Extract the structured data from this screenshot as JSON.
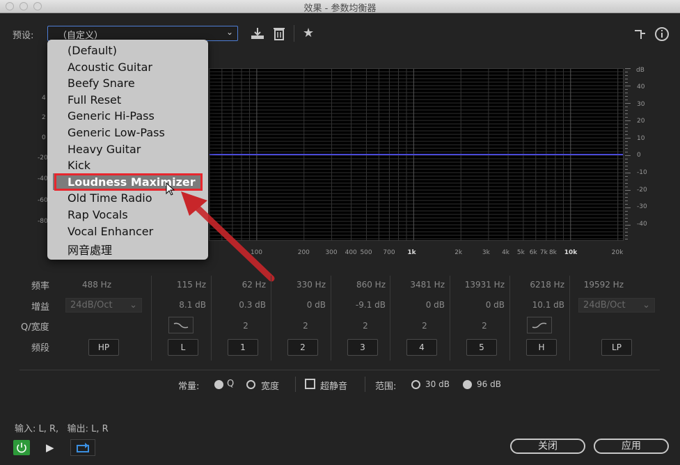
{
  "window": {
    "title": "效果 - 参数均衡器"
  },
  "preset": {
    "label": "预设:",
    "current": "（自定义）",
    "options": [
      "(Default)",
      "Acoustic Guitar",
      "Beefy Snare",
      "Full Reset",
      "Generic Hi-Pass",
      "Generic Low-Pass",
      "Heavy Guitar",
      "Kick",
      "Loudness Maximizer",
      "Old Time Radio",
      "Rap Vocals",
      "Vocal Enhancer",
      "网音處理"
    ],
    "highlighted": "Loudness Maximizer"
  },
  "toolbar": {
    "icons": [
      "save-preset-icon",
      "delete-icon",
      "star-icon",
      "routing-icon",
      "info-icon"
    ]
  },
  "graph": {
    "db_unit": "dB",
    "db_ticks": [
      "40",
      "30",
      "20",
      "10",
      "0",
      "-10",
      "-20",
      "-30",
      "-40"
    ],
    "left_partial": [
      "4",
      "2",
      "0",
      "-20",
      "-40",
      "-60",
      "-80"
    ],
    "hz_ticks": [
      "100",
      "200",
      "300",
      "400",
      "500",
      "700",
      "1k",
      "2k",
      "3k",
      "4k",
      "5k",
      "6k",
      "7k",
      "8k",
      "10k",
      "20k"
    ]
  },
  "bands": {
    "row_labels": {
      "freq": "频率",
      "gain": "增益",
      "q": "Q/宽度",
      "band": "频段"
    },
    "hp": {
      "freq": "488 Hz",
      "slope": "24dB/Oct",
      "button": "HP"
    },
    "lp": {
      "freq": "19592 Hz",
      "slope": "24dB/Oct",
      "button": "LP"
    },
    "mid": [
      {
        "freq": "115 Hz",
        "gain": "8.1 dB",
        "q": "",
        "button": "L"
      },
      {
        "freq": "62 Hz",
        "gain": "0.3 dB",
        "q": "2",
        "button": "1"
      },
      {
        "freq": "330 Hz",
        "gain": "0 dB",
        "q": "2",
        "button": "2"
      },
      {
        "freq": "860 Hz",
        "gain": "-9.1 dB",
        "q": "2",
        "button": "3"
      },
      {
        "freq": "3481 Hz",
        "gain": "0 dB",
        "q": "2",
        "button": "4"
      },
      {
        "freq": "13931 Hz",
        "gain": "0 dB",
        "q": "2",
        "button": "5"
      },
      {
        "freq": "6218 Hz",
        "gain": "10.1 dB",
        "q": "",
        "button": "H"
      }
    ]
  },
  "options": {
    "constant_label": "常量:",
    "q_label": "Q",
    "width_label": "宽度",
    "ultra_quiet_label": "超静音",
    "range_label": "范围:",
    "range_30": "30 dB",
    "range_96": "96 dB"
  },
  "io": {
    "text": "输入: L, R,   输出: L, R"
  },
  "buttons": {
    "close": "关闭",
    "apply": "应用"
  }
}
